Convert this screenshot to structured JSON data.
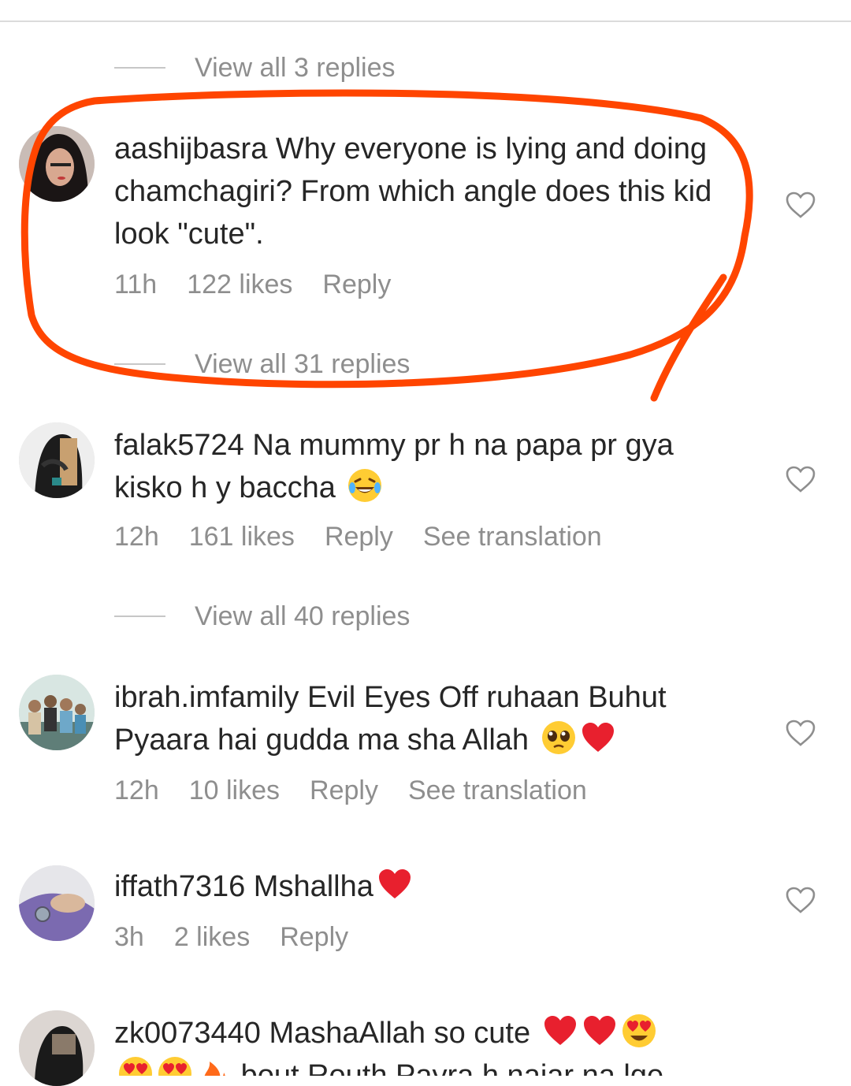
{
  "replies": {
    "r1": "View all 3 replies",
    "r2": "View all 31 replies",
    "r3": "View all 40 replies"
  },
  "comments": [
    {
      "username": "aashijbasra",
      "text": "Why everyone is lying and doing chamchagiri? From which angle does this kid look \"cute\".",
      "time": "11h",
      "likes": "122 likes",
      "reply": "Reply"
    },
    {
      "username": "falak5724",
      "text": "Na mummy pr h na papa pr gya kisko h y baccha",
      "emoji": "laughing-tears-emoji",
      "time": "12h",
      "likes": "161 likes",
      "reply": "Reply",
      "translate": "See translation"
    },
    {
      "username": "ibrah.imfamily",
      "text": "Evil Eyes Off ruhaan Buhut Pyaara hai gudda ma sha Allah",
      "emoji": "pleading-face-emoji, red-heart-emoji",
      "time": "12h",
      "likes": "10 likes",
      "reply": "Reply",
      "translate": "See translation"
    },
    {
      "username": "iffath7316",
      "text": "Mshallha",
      "emoji": "red-heart-emoji",
      "time": "3h",
      "likes": "2 likes",
      "reply": "Reply"
    },
    {
      "username": "zk0073440",
      "text": "MashaAllah so cute",
      "emoji": "red-heart-emoji x2, heart-eyes-emoji",
      "partial_line": "bout  Routh  Payra h najar na lge"
    }
  ],
  "colors": {
    "annotation": "#ff4500",
    "secondary_text": "#8e8e8e",
    "primary_text": "#262626",
    "heart_red": "#e8202e"
  }
}
